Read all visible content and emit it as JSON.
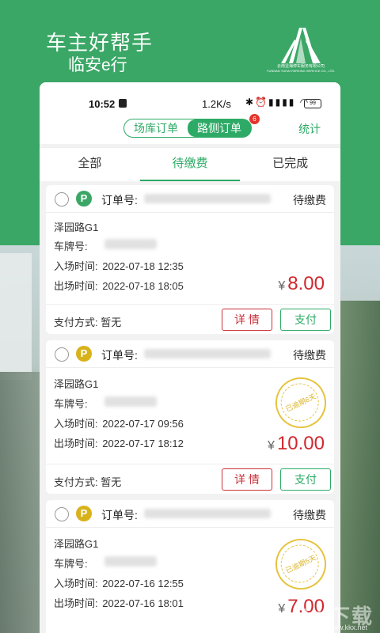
{
  "brand": {
    "title": "车主好帮手",
    "subtitle": "临安e行",
    "logo_text": "云南昱海停车服务有限公司",
    "logo_text_en": "YUNNAN YUHAI PARKING SERVICE CO., LTD."
  },
  "status_bar": {
    "time": "10:52",
    "speed": "1.2K/s",
    "icons": "✱⏰▮▮▮▮ ◠",
    "battery": "99"
  },
  "header": {
    "segments": [
      "场库订单",
      "路侧订单"
    ],
    "active_segment": "路侧订单",
    "badge_count": "6",
    "stats_label": "统计"
  },
  "tabs": {
    "items": [
      "全部",
      "待缴费",
      "已完成"
    ],
    "active": "待缴费"
  },
  "orders": [
    {
      "order_label": "订单号:",
      "state": "待缴费",
      "p_icon": "P",
      "p_color": "#3aa766",
      "road": "泽园路G1",
      "plate_label": "车牌号:",
      "entry_label": "入场时间:",
      "entry_time": "2022-07-18 12:35",
      "exit_label": "出场时间:",
      "exit_time": "2022-07-18 18:05",
      "currency": "¥",
      "amount": "8.00",
      "pay_method_label": "支付方式:",
      "pay_method": "暂无",
      "detail_label": "详 情",
      "pay_label": "支付"
    },
    {
      "order_label": "订单号:",
      "state": "待缴费",
      "p_icon": "P",
      "p_color": "#d8b21a",
      "road": "泽园路G1",
      "plate_label": "车牌号:",
      "entry_label": "入场时间:",
      "entry_time": "2022-07-17 09:56",
      "exit_label": "出场时间:",
      "exit_time": "2022-07-17 18:12",
      "currency": "¥",
      "amount": "10.00",
      "stamp": "已逾期6天",
      "pay_method_label": "支付方式:",
      "pay_method": "暂无",
      "detail_label": "详 情",
      "pay_label": "支付"
    },
    {
      "order_label": "订单号:",
      "state": "待缴费",
      "p_icon": "P",
      "p_color": "#d8b21a",
      "road": "泽园路G1",
      "plate_label": "车牌号:",
      "entry_label": "入场时间:",
      "entry_time": "2022-07-16 12:55",
      "exit_label": "出场时间:",
      "exit_time": "2022-07-16 18:01",
      "currency": "¥",
      "amount": "7.00",
      "stamp": "已逾期5天"
    }
  ],
  "watermark": {
    "text": "kk下载",
    "sub": "www.kkx.net"
  }
}
